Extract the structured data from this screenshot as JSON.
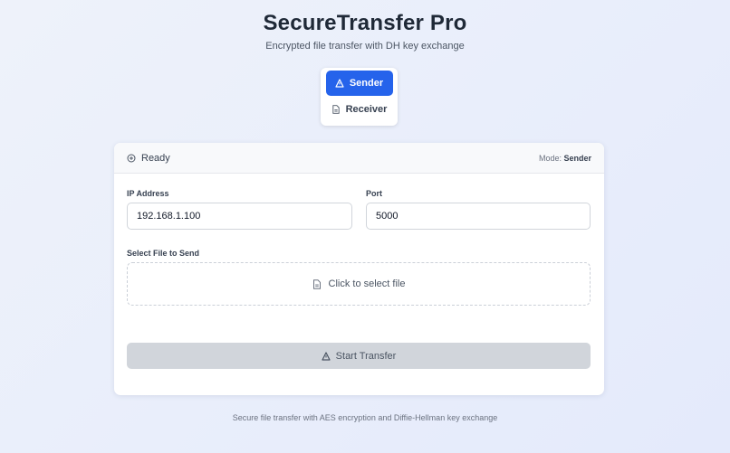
{
  "header": {
    "title": "SecureTransfer Pro",
    "subtitle": "Encrypted file transfer with DH key exchange"
  },
  "mode_switch": {
    "sender_label": "Sender",
    "receiver_label": "Receiver",
    "selected": "Sender"
  },
  "card": {
    "status_text": "Ready",
    "mode_prefix": "Mode:",
    "mode_value": "Sender",
    "ip": {
      "label": "IP Address",
      "value": "192.168.1.100"
    },
    "port": {
      "label": "Port",
      "value": "5000"
    },
    "file": {
      "label": "Select File to Send",
      "placeholder": "Click to select file"
    },
    "start_label": "Start Transfer"
  },
  "footer": {
    "text": "Secure file transfer with AES encryption and Diffie-Hellman key exchange"
  },
  "colors": {
    "accent": "#2563eb",
    "disabled_button": "#d1d5db"
  },
  "icons": {
    "sender": "send-triangle-icon",
    "receiver": "file-icon",
    "status": "status-circle-icon",
    "file": "file-icon",
    "start": "send-triangle-icon"
  }
}
